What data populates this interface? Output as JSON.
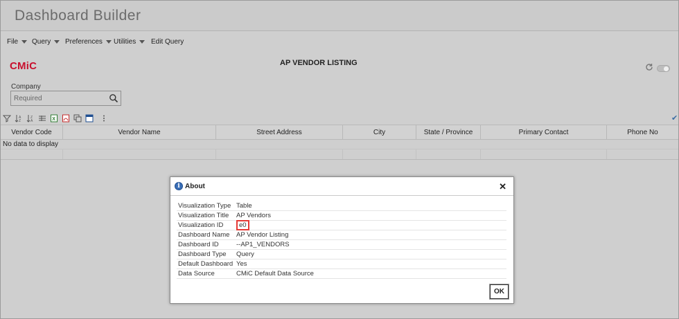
{
  "app": {
    "title": "Dashboard Builder"
  },
  "menu": [
    {
      "label": "File"
    },
    {
      "label": "Query"
    },
    {
      "label": "Preferences"
    },
    {
      "label": "Utilities"
    },
    {
      "label": "Edit Query"
    }
  ],
  "header": {
    "logo": "CMiC",
    "listing_title": "AP VENDOR LISTING"
  },
  "filter": {
    "company_label": "Company",
    "company_placeholder": "Required"
  },
  "grid": {
    "columns": [
      "Vendor Code",
      "Vendor Name",
      "Street Address",
      "City",
      "State / Province",
      "Primary Contact",
      "Phone No"
    ],
    "empty_text": "No data to display"
  },
  "dialog": {
    "title": "About",
    "rows": [
      {
        "label": "Visualization Type",
        "value": "Table"
      },
      {
        "label": "Visualization Title",
        "value": "AP Vendors"
      },
      {
        "label": "Visualization ID",
        "value": "e0"
      },
      {
        "label": "Dashboard Name",
        "value": "AP Vendor Listing"
      },
      {
        "label": "Dashboard ID",
        "value": "--AP1_VENDORS"
      },
      {
        "label": "Dashboard Type",
        "value": "Query"
      },
      {
        "label": "Default Dashboard",
        "value": "Yes"
      },
      {
        "label": "Data Source",
        "value": "CMiC Default Data Source"
      }
    ],
    "ok_label": "OK",
    "highlight_color": "#e53935"
  },
  "colors": {
    "brand": "#c8102e",
    "info": "#3b6fb6"
  }
}
